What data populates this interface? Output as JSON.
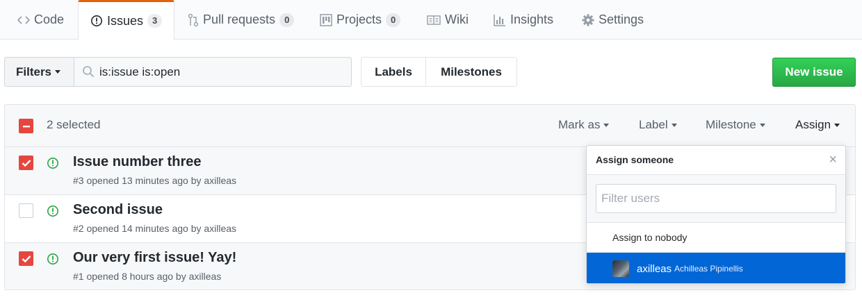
{
  "tabs": [
    {
      "label": "Code",
      "icon": "code-icon"
    },
    {
      "label": "Issues",
      "icon": "issue-opened-icon",
      "count": "3",
      "selected": true
    },
    {
      "label": "Pull requests",
      "icon": "git-pull-request-icon",
      "count": "0"
    },
    {
      "label": "Projects",
      "icon": "project-icon",
      "count": "0"
    },
    {
      "label": "Wiki",
      "icon": "book-icon"
    },
    {
      "label": "Insights",
      "icon": "graph-icon"
    },
    {
      "label": "Settings",
      "icon": "gear-icon"
    }
  ],
  "subnav": {
    "filters_label": "Filters",
    "search_value": "is:issue is:open",
    "labels_label": "Labels",
    "milestones_label": "Milestones",
    "new_issue_label": "New issue"
  },
  "bulk": {
    "selected_text": "2 selected",
    "menus": [
      "Mark as",
      "Label",
      "Milestone",
      "Assign"
    ]
  },
  "issues": [
    {
      "title": "Issue number three",
      "meta": "#3 opened 13 minutes ago by axilleas",
      "checked": true
    },
    {
      "title": "Second issue",
      "meta": "#2 opened 14 minutes ago by axilleas",
      "checked": false
    },
    {
      "title": "Our very first issue! Yay!",
      "meta": "#1 opened 8 hours ago by axilleas",
      "checked": true
    }
  ],
  "assign_dropdown": {
    "title": "Assign someone",
    "filter_placeholder": "Filter users",
    "nobody_label": "Assign to nobody",
    "user": {
      "login": "axilleas",
      "name": "Achilleas Pipinellis"
    }
  },
  "colors": {
    "accent_tab": "#e36209",
    "new_issue_green": "#28a745",
    "checkbox_red": "#e5473f",
    "open_issue_green": "#28a745",
    "selected_user_blue": "#0366d6"
  }
}
